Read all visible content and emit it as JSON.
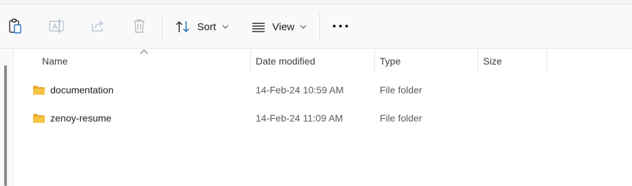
{
  "toolbar": {
    "icons": [
      "paste-icon",
      "rename-icon",
      "share-icon",
      "delete-icon"
    ],
    "sort_label": "Sort",
    "view_label": "View",
    "more_icon": "more-options-icon"
  },
  "columns": {
    "name": "Name",
    "date_modified": "Date modified",
    "type": "Type",
    "size": "Size"
  },
  "rows": [
    {
      "name": "documentation",
      "date": "14-Feb-24 10:59 AM",
      "type": "File folder",
      "size": ""
    },
    {
      "name": "zenoy-resume",
      "date": "14-Feb-24 11:09 AM",
      "type": "File folder",
      "size": ""
    }
  ],
  "colors": {
    "folder": "#f6c443",
    "accent": "#0067c0"
  }
}
